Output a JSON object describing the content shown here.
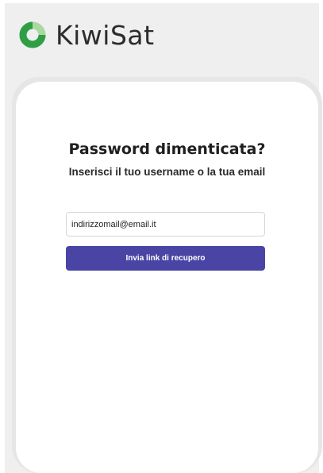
{
  "brand": {
    "name": "KiwiSat",
    "logo_icon": "kiwisat-ring-logo-icon",
    "colors": {
      "logo_dark": "#2f9e45",
      "logo_light": "#a8d9a0"
    }
  },
  "recovery_form": {
    "title": "Password dimenticata?",
    "subtitle": "Inserisci il tuo username o la tua email",
    "email_input": {
      "value": "indirizzomail@email.it"
    },
    "submit_label": "Invia link di recupero",
    "button_color": "#4a45a4"
  }
}
